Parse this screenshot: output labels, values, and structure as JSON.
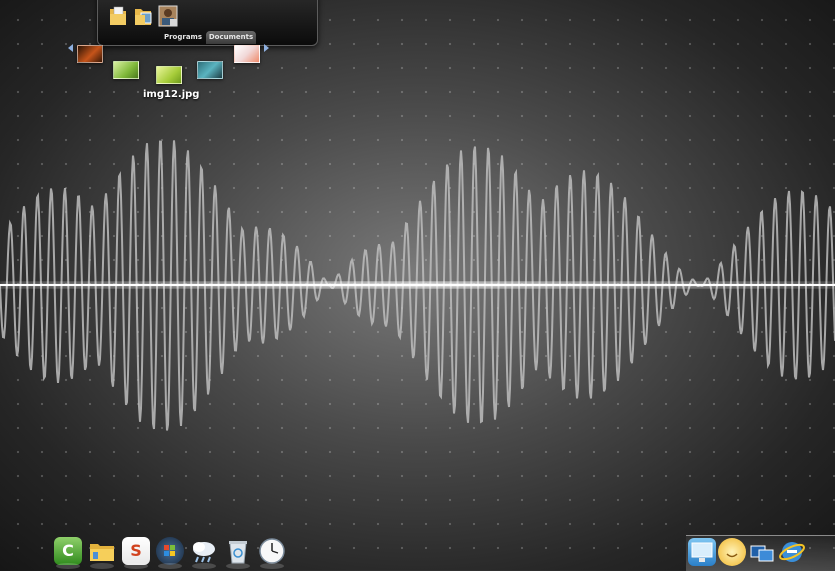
{
  "stack": {
    "tabs": [
      "Programs",
      "Documents"
    ],
    "active_tab": "Documents",
    "icons": [
      "folder-document-icon",
      "folder-pictures-icon",
      "photo-icon"
    ]
  },
  "preview": {
    "thumbnails": [
      "orange-photo-thumb",
      "green-leaf-thumb",
      "green-field-thumb",
      "teal-flower-thumb",
      "pink-flower-thumb"
    ],
    "caption": "img12.jpg"
  },
  "left_dock": {
    "icons": [
      "camtasia-icon",
      "folder-icon",
      "slide-app-icon",
      "windows-start-icon",
      "weather-icon",
      "recycle-bin-icon",
      "clock-icon"
    ]
  },
  "right_dock": {
    "icons": [
      "monitor-icon",
      "smiley-icon",
      "window-switch-icon",
      "internet-explorer-icon"
    ]
  },
  "colors": {
    "accent_arrow": "#8fb0e0",
    "wave": "#bdbdbd",
    "highlight": "#ffffff"
  }
}
